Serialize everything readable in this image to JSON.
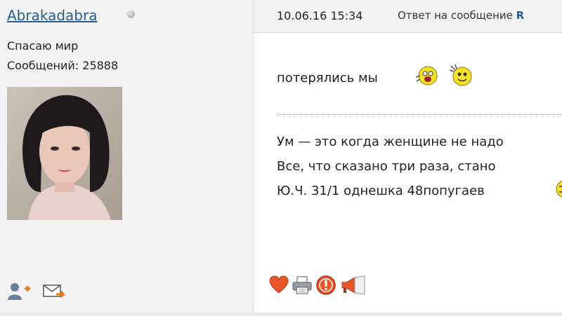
{
  "author": {
    "name": "Abrakadabra",
    "title": "Спасаю мир",
    "posts": "Сообщений: 25888"
  },
  "post": {
    "date": "10.06.16 15:34",
    "reply_prefix": "Ответ на сообщение ",
    "reply_target": "R",
    "message": "потерялись мы"
  },
  "signature": {
    "line1": "Ум — это когда женщине не надо",
    "line2": "Все, что сказано три раза, стано",
    "line3": "Ю.Ч. 31/1 однешка 48попугаев"
  },
  "icons": {
    "add_friend": "add-friend-icon",
    "send_pm": "send-message-icon",
    "like": "heart-icon",
    "print": "printer-icon",
    "report": "warning-icon",
    "quote": "megaphone-icon"
  },
  "colors": {
    "link": "#2a5d8f",
    "panel": "#f2f2f2"
  }
}
